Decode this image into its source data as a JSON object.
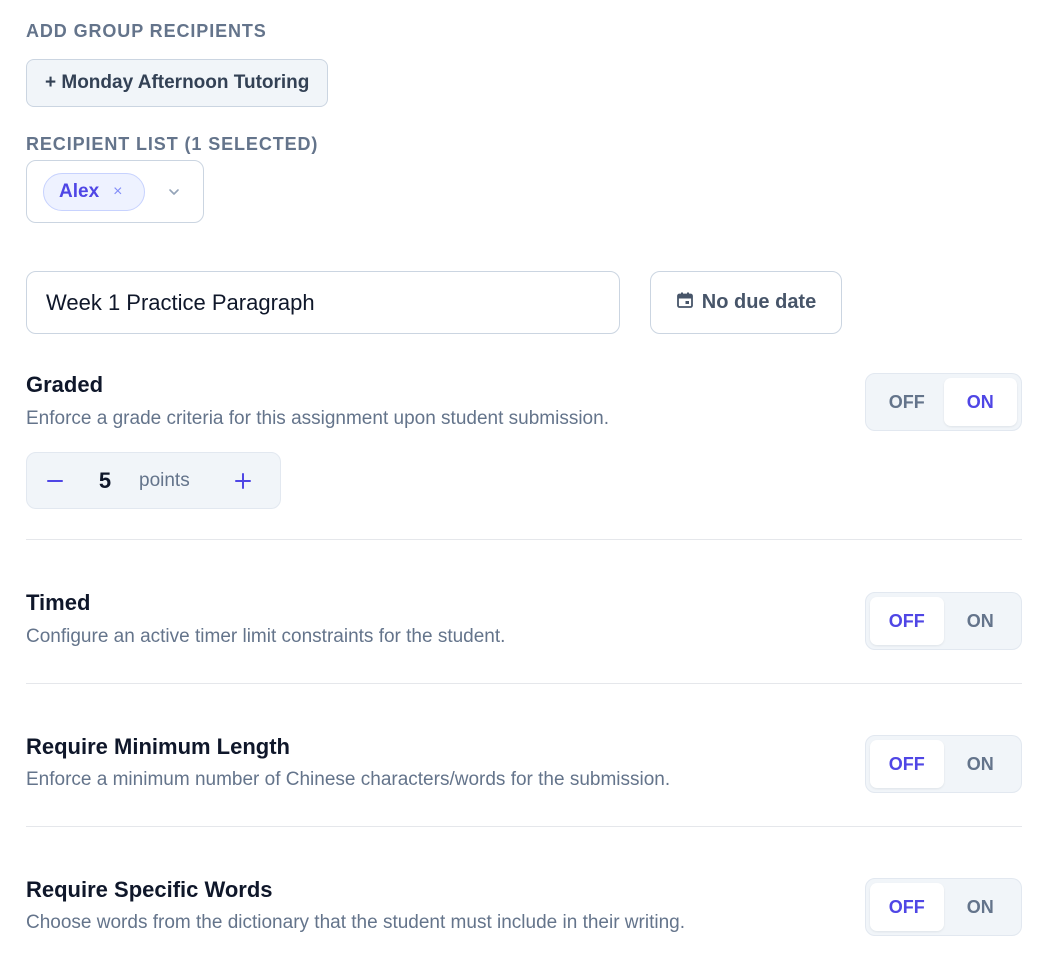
{
  "group_section": {
    "label": "ADD GROUP RECIPIENTS",
    "add_group_button": "+ Monday Afternoon Tutoring"
  },
  "recipient_section": {
    "label": "RECIPIENT LIST (1 SELECTED)",
    "chips": [
      {
        "name": "Alex",
        "remove_glyph": "×"
      }
    ],
    "dropdown_icon": "chevron-down-icon"
  },
  "assignment": {
    "title_value": "Week 1 Practice Paragraph",
    "due_date_label": "No due date",
    "due_date_icon": "calendar-icon"
  },
  "options": [
    {
      "title": "Graded",
      "description": "Enforce a grade criteria for this assignment upon student submission.",
      "off_label": "OFF",
      "on_label": "ON",
      "state": "on"
    },
    {
      "title": "Timed",
      "description": "Configure an active timer limit constraints for the student.",
      "off_label": "OFF",
      "on_label": "ON",
      "state": "off"
    },
    {
      "title": "Require Minimum Length",
      "description": "Enforce a minimum number of Chinese characters/words for the submission.",
      "off_label": "OFF",
      "on_label": "ON",
      "state": "off"
    },
    {
      "title": "Require Specific Words",
      "description": "Choose words from the dictionary that the student must include in their writing.",
      "off_label": "OFF",
      "on_label": "ON",
      "state": "off"
    }
  ],
  "points_stepper": {
    "value": "5",
    "unit": "points",
    "decrement_icon": "minus-icon",
    "increment_icon": "plus-icon"
  },
  "colors": {
    "accent": "#4f46e5",
    "muted_text": "#64748b",
    "border": "#cbd5e1",
    "control_bg": "#f1f5f9"
  }
}
